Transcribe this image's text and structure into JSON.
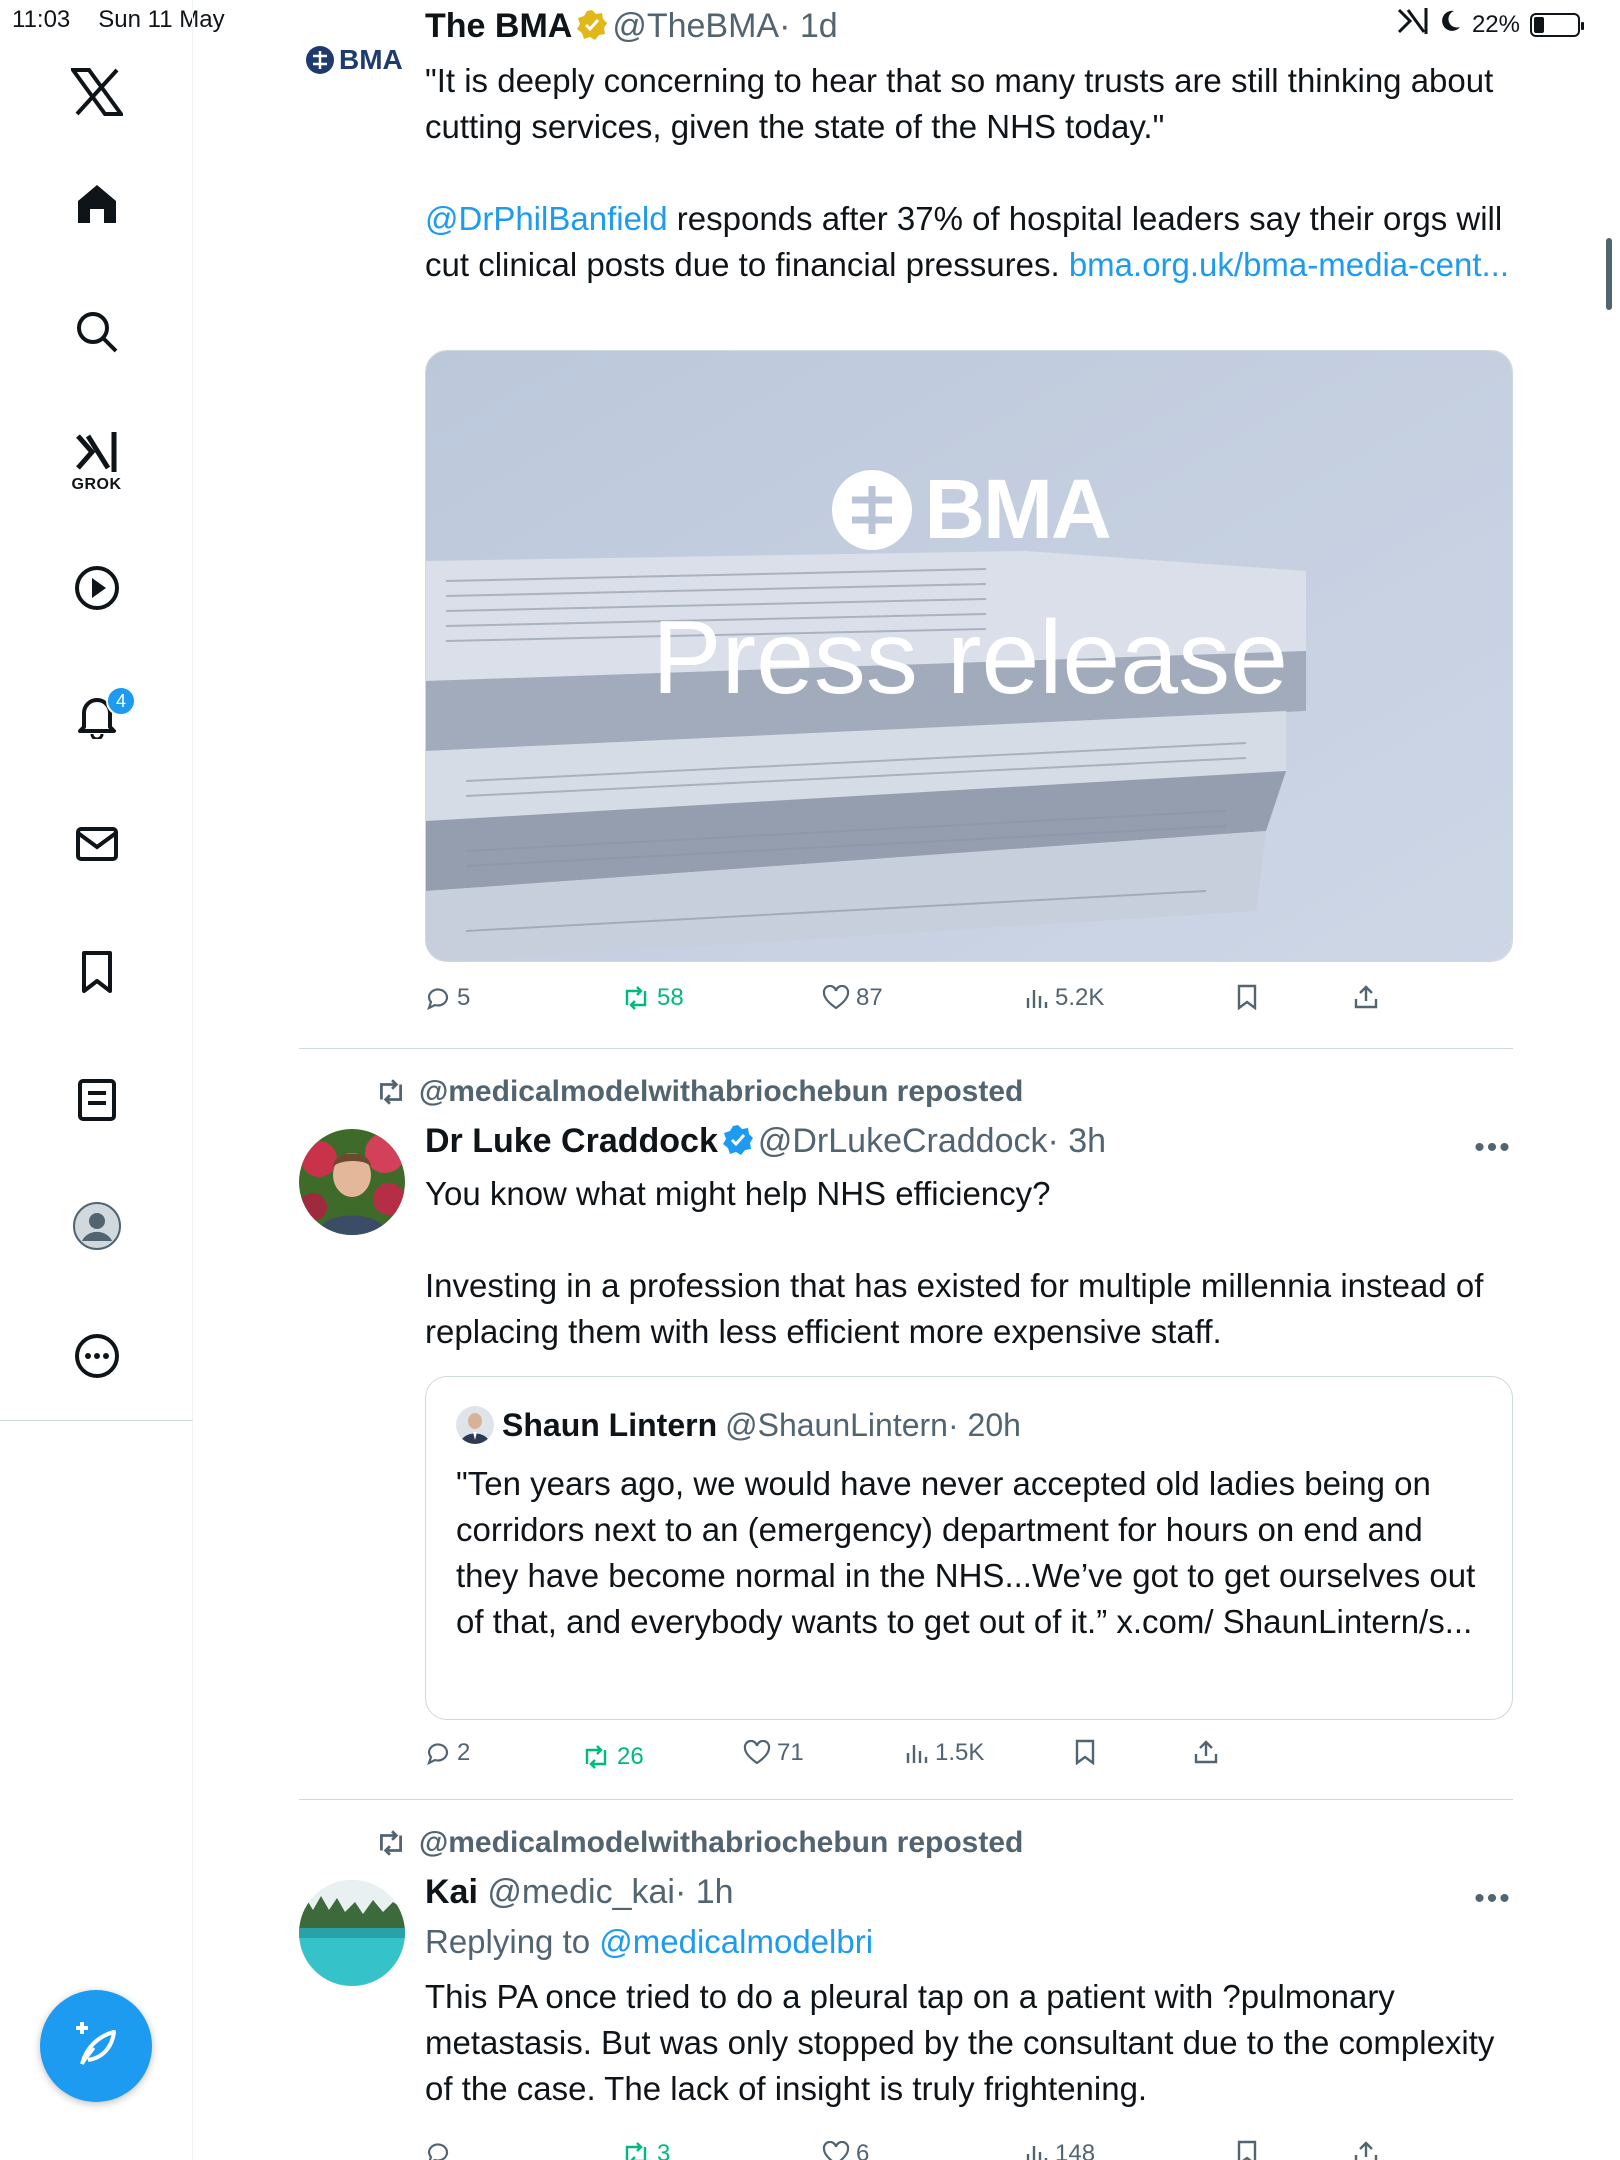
{
  "status_bar": {
    "time": "11:03",
    "date": "Sun 11 May",
    "battery": "22%"
  },
  "sidebar": {
    "grok_label": "GROK",
    "notifications_badge": "4"
  },
  "tweets": [
    {
      "name": "The BMA",
      "handle": "@TheBMA",
      "time": "· 1d",
      "avatar_text": "BMA",
      "text_p1": "\"It is deeply concerning to hear that so many trusts are still thinking about cutting services, given the state of the NHS today.\"",
      "mention": "@DrPhilBanfield",
      "text_p2": " responds after 37% of hospital leaders say their orgs will cut clinical posts due to financial pressures. ",
      "link": "bma.org.uk/bma-media-cent...",
      "media": {
        "logo_text": "BMA",
        "headline": "Press release"
      },
      "stats": {
        "replies": "5",
        "reposts": "58",
        "likes": "87",
        "views": "5.2K"
      }
    },
    {
      "reposted_by": "@medicalmodelwithabriochebun reposted",
      "name": "Dr Luke Craddock",
      "handle": "@DrLukeCraddock",
      "time": "· 3h",
      "text_p1": "You know what might help NHS efficiency?",
      "text_p2": "Investing in a profession that has existed for multiple millennia instead of replacing them with less efficient more expensive staff.",
      "quote": {
        "name": "Shaun Lintern",
        "handle": "@ShaunLintern",
        "time": "· 20h",
        "text": "\"Ten years ago, we would have never accepted old ladies being on corridors next to an (emergency) department for hours on end and they have become normal in the NHS...We’ve got to get ourselves out of that, and everybody wants to get out of it.” x.com/ ShaunLintern/s..."
      },
      "stats": {
        "replies": "2",
        "reposts": "26",
        "likes": "71",
        "views": "1.5K"
      }
    },
    {
      "reposted_by": "@medicalmodelwithabriochebun reposted",
      "name": "Kai",
      "handle": "@medic_kai",
      "time": "· 1h",
      "replying_prefix": "Replying to ",
      "replying_to": "@medicalmodelbri",
      "text_p1": "This PA once tried to do a pleural tap on a patient with ?pulmonary metastasis. But was only stopped by the consultant due to the complexity of the case. The lack of insight is truly frightening.",
      "stats": {
        "replies": "",
        "reposts": "3",
        "likes": "6",
        "views": "148"
      }
    }
  ],
  "colors": {
    "accent": "#1d9bf0",
    "repost_green": "#00ba7c",
    "muted": "#536471",
    "text": "#0f1419"
  }
}
